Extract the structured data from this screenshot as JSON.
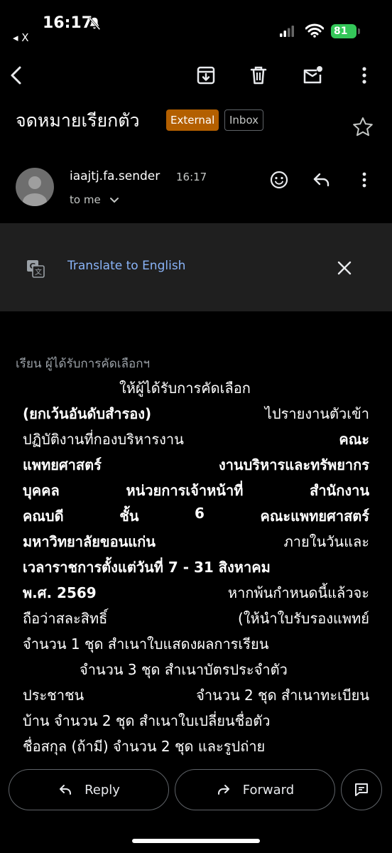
{
  "status_bar": {
    "time": "16:17",
    "back_app": "◂ X",
    "battery": "81"
  },
  "email": {
    "subject": "จดหมายเรียกตัว",
    "badge_external": "External",
    "badge_inbox": "Inbox",
    "sender": "iaajtj.fa.sender",
    "time": "16:17",
    "to": "to me"
  },
  "translate": {
    "label": "Translate to English"
  },
  "body": {
    "greeting": "เรียน ผู้ได้รับการคัดเลือกฯ",
    "lines": [
      [
        "ให้ผู้ได้รับการคัดเลือก"
      ],
      [
        "(ยกเว้นอันดับสำรอง)",
        "ไปรายงานตัวเข้า"
      ],
      [
        "ปฏิบัติงานที่กองบริหารงาน",
        "คณะ"
      ],
      [
        "แพทยศาสตร์",
        "งานบริหารและทรัพยากร"
      ],
      [
        "บุคคล",
        "หน่วยการเจ้าหน้าที่",
        "สำนักงาน"
      ],
      [
        "คณบดี",
        "ชั้น",
        "6",
        "คณะแพทยศาสตร์"
      ],
      [
        "มหาวิทยาลัยขอนแก่น",
        "ภายในวันและ"
      ],
      [
        "เวลาราชการตั้งแต่วันที่ 7 - 31 สิงหาคม"
      ],
      [
        "พ.ศ. 2569",
        "หากพ้นกำหนดนี้แล้วจะ"
      ],
      [
        "ถือว่าสละสิทธิ์",
        "(ให้นำใบรับรองแพทย์"
      ],
      [
        "จำนวน 1 ชุด สำเนาใบแสดงผลการเรียน"
      ],
      [
        "จำนวน 3 ชุด สำเนาบัตรประจำตัว"
      ],
      [
        "ประชาชน",
        "จำนวน 2 ชุด สำเนาทะเบียน"
      ],
      [
        "บ้าน จำนวน 2 ชุด สำเนาใบเปลี่ยนชื่อตัว"
      ],
      [
        "ชื่อสกุล (ถ้ามี) จำนวน 2 ชุด และรูปถ่าย"
      ]
    ]
  },
  "actions": {
    "reply": "Reply",
    "forward": "Forward"
  },
  "colors": {
    "background": "#000000",
    "external": "#b35f00",
    "link": "#8ab4f8",
    "translate_bar": "#1f1f1f"
  }
}
